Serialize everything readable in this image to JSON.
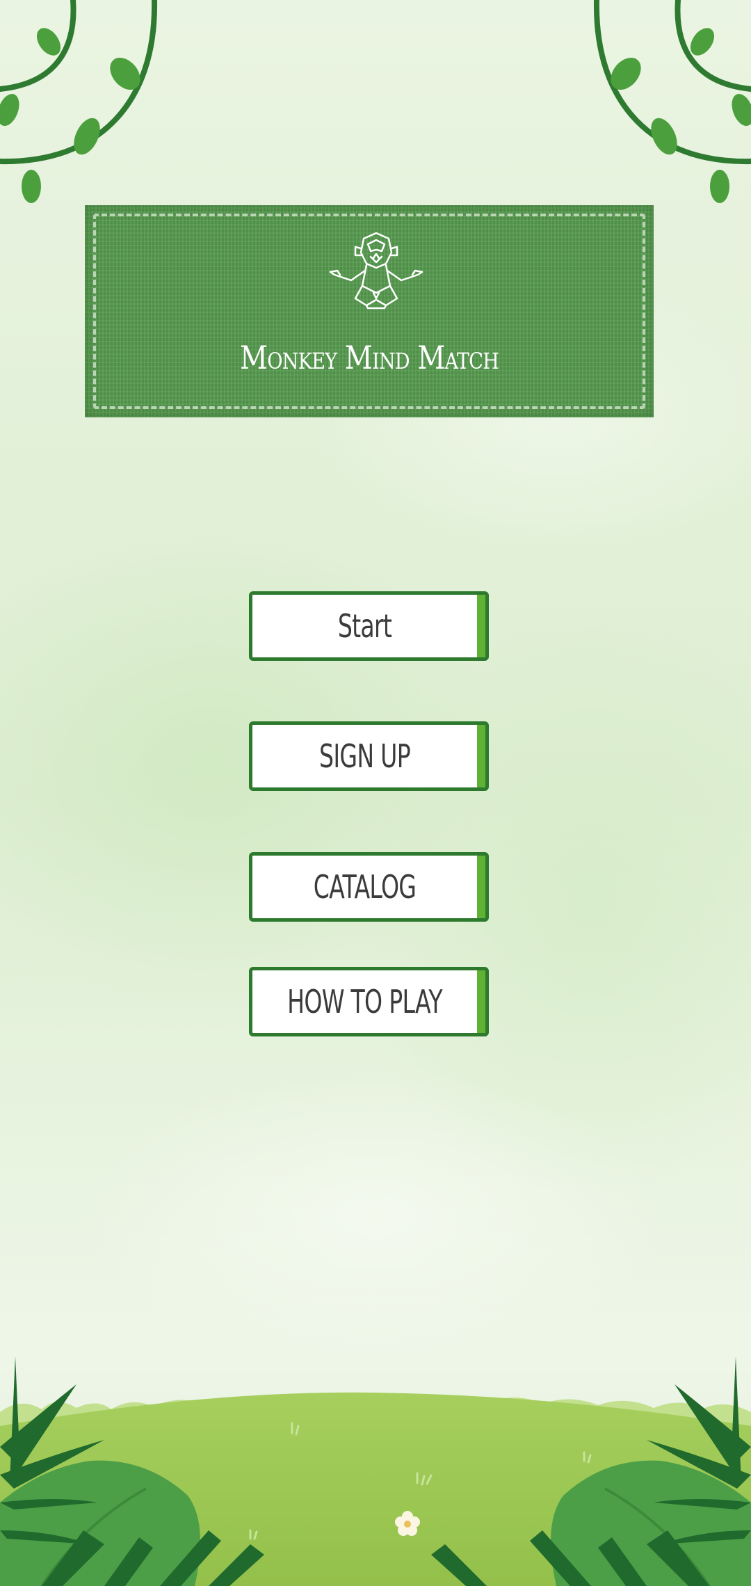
{
  "title": "Monkey Mind Match",
  "menu": {
    "start": "Start",
    "signup": "SIGN UP",
    "catalog": "CATALOG",
    "how_to_play": "HOW TO PLAY"
  },
  "icons": {
    "logo": "meditating-monkey-icon",
    "decor_top": "vine-icon",
    "decor_bottom": "jungle-grass-icon"
  },
  "colors": {
    "card_green": "#569a4e",
    "button_border": "#2d7a2e",
    "button_accent": "#5fb233",
    "button_text": "#3b3b3b"
  }
}
